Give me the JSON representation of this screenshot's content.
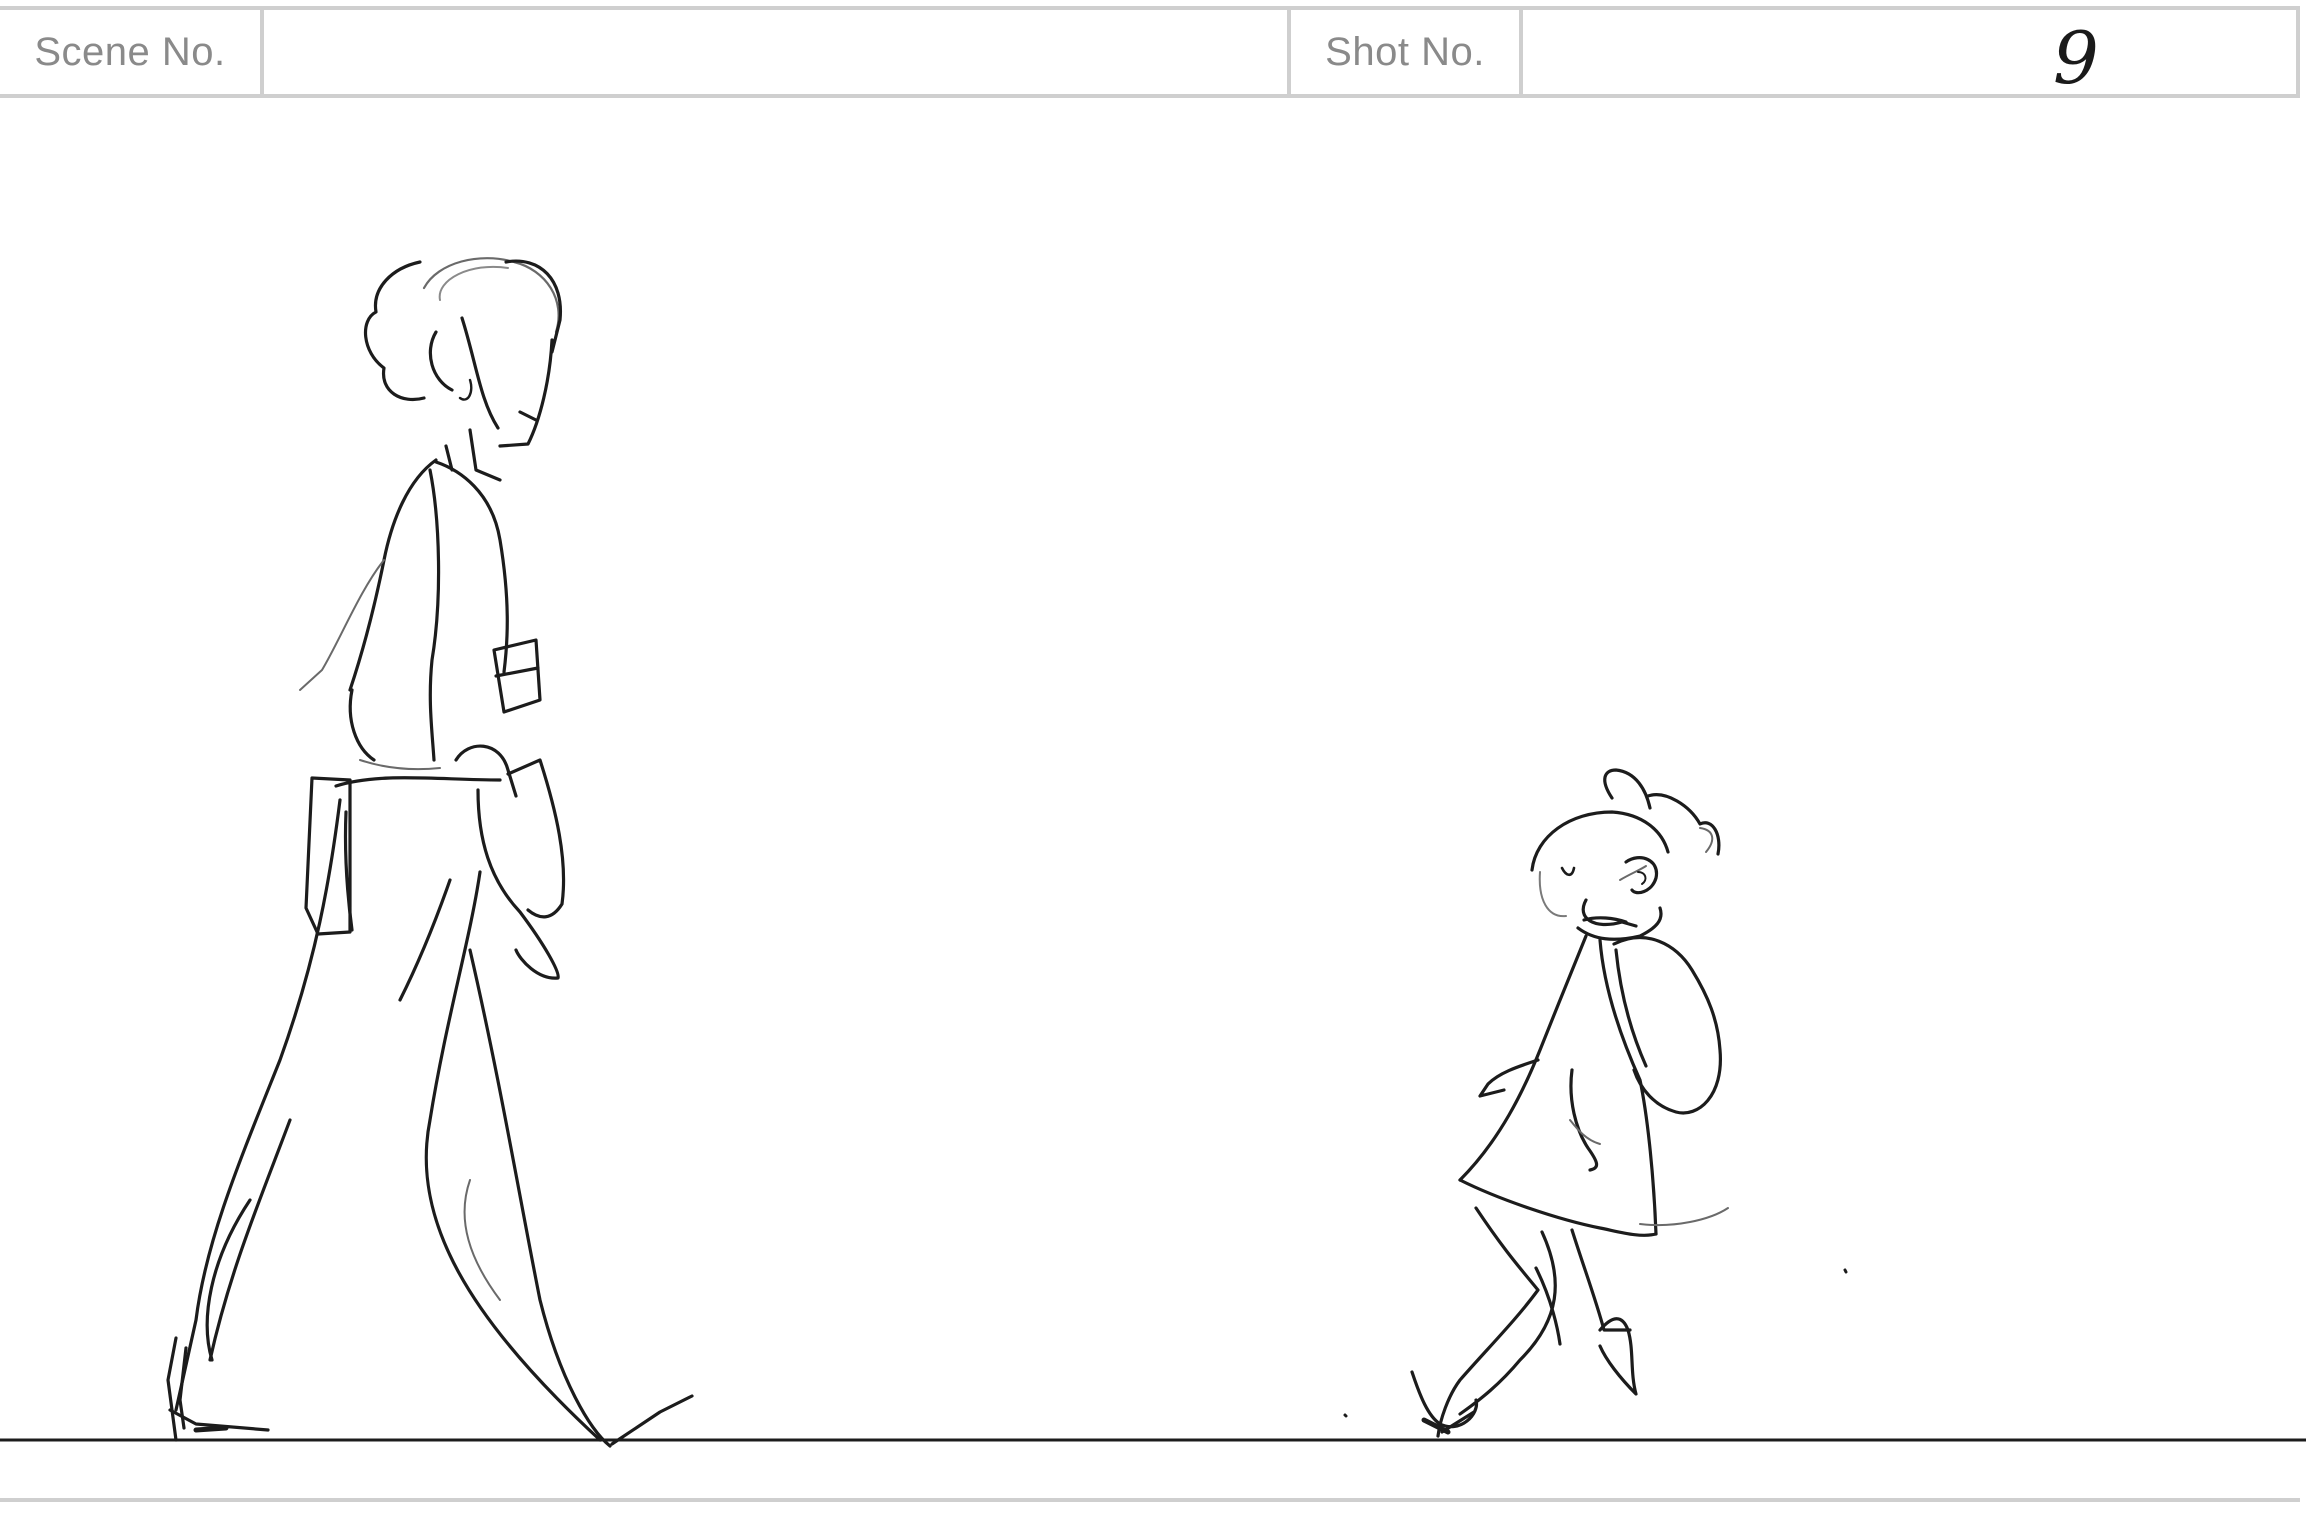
{
  "header": {
    "scene_label": "Scene No.",
    "scene_value": "",
    "shot_label": "Shot No.",
    "shot_value": "9"
  },
  "panel": {
    "figures": [
      {
        "name": "adult-woman-walking"
      },
      {
        "name": "child-with-backpack-walking"
      }
    ]
  }
}
